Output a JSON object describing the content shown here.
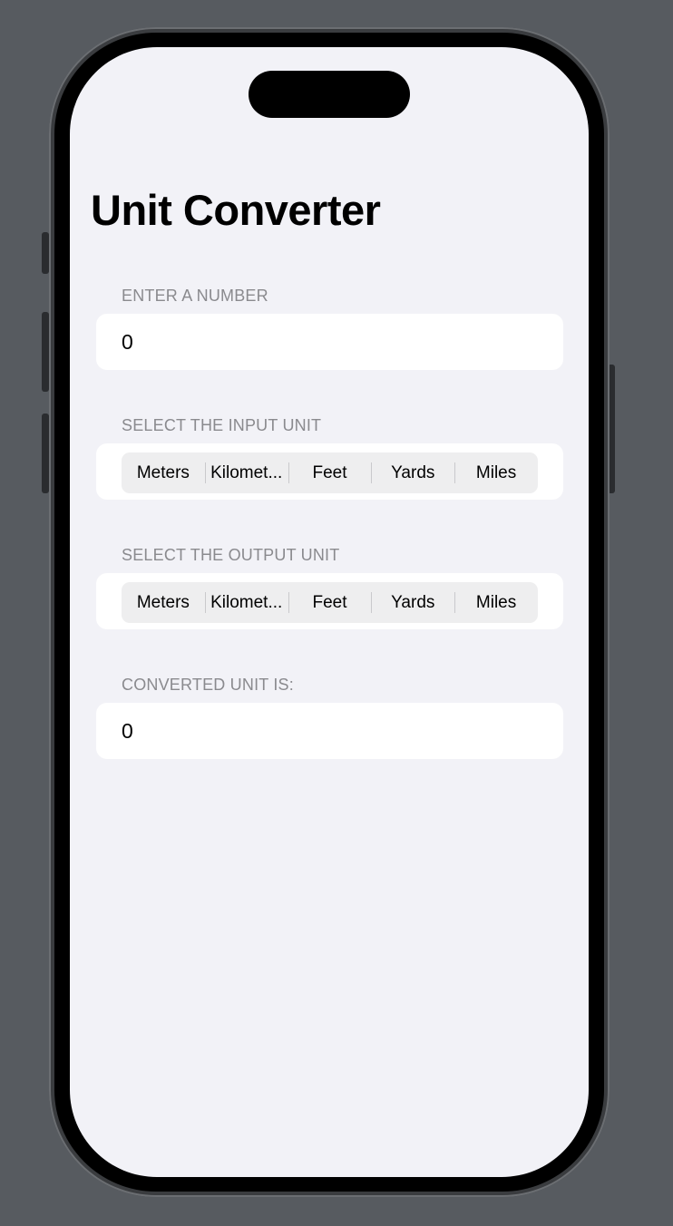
{
  "app": {
    "title": "Unit Converter"
  },
  "input_section": {
    "header": "ENTER A NUMBER",
    "value": "0"
  },
  "input_unit_section": {
    "header": "SELECT THE INPUT UNIT",
    "options": [
      "Meters",
      "Kilomet...",
      "Feet",
      "Yards",
      "Miles"
    ]
  },
  "output_unit_section": {
    "header": "SELECT THE OUTPUT UNIT",
    "options": [
      "Meters",
      "Kilomet...",
      "Feet",
      "Yards",
      "Miles"
    ]
  },
  "result_section": {
    "header": "CONVERTED UNIT IS:",
    "value": "0"
  },
  "colors": {
    "background": "#f2f2f7",
    "card": "#ffffff",
    "section_header": "#8a8a8e",
    "segmented_track": "#eeeeef"
  }
}
